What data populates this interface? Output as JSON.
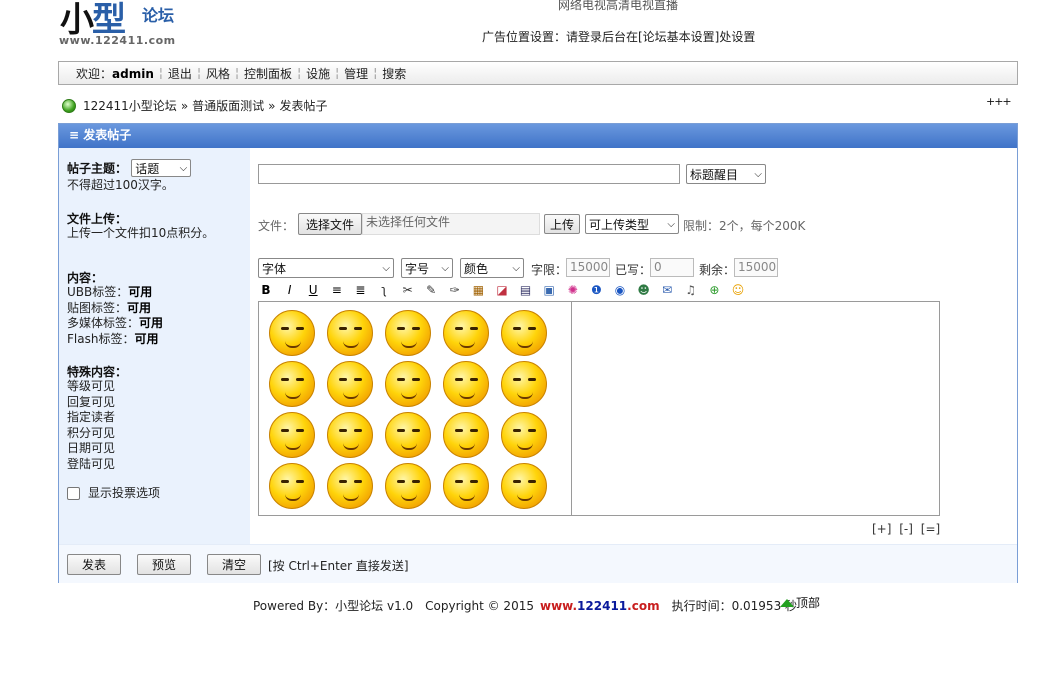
{
  "header": {
    "logo_big": "小",
    "logo_big2": "型",
    "logo_small": "论坛",
    "logo_url": "www.122411.com",
    "ad_top": "网络电视高清电视直播",
    "ad_setting": "广告位置设置：请登录后台在[论坛基本设置]处设置"
  },
  "nav": {
    "welcome": "欢迎：",
    "user": "admin",
    "items": [
      "退出",
      "风格",
      "控制面板",
      "设施",
      "管理",
      "搜索"
    ]
  },
  "breadcrumb": {
    "items": [
      "122411小型论坛",
      "普通版面测试",
      "发表帖子"
    ],
    "separator": "»",
    "jump": "+++"
  },
  "panel": {
    "title": "≡ 发表帖子"
  },
  "side": {
    "subject_label": "帖子主题：",
    "subject_select": "话题",
    "subject_note": "不得超过100汉字。",
    "upload_label": "文件上传：",
    "upload_note": "上传一个文件扣10点积分。",
    "content_label": "内容：",
    "ubb": [
      "UBB标签：",
      "可用"
    ],
    "img": [
      "贴图标签：",
      "可用"
    ],
    "media": [
      "多媒体标签：",
      "可用"
    ],
    "flash": [
      "Flash标签：",
      "可用"
    ],
    "special_label": "特殊内容：",
    "special_items": [
      "等级可见",
      "回复可见",
      "指定读者",
      "积分可见",
      "日期可见",
      "登陆可见"
    ],
    "vote_label": "显示投票选项"
  },
  "content": {
    "title_value": "",
    "title_color_select": "标题醒目",
    "file_label": "文件：",
    "choose_file": "选择文件",
    "no_file": "未选择任何文件",
    "upload_button": "上传",
    "upload_type": "可上传类型",
    "limit_text": "限制：2个，每个200K",
    "font_select": "字体",
    "size_select": "字号",
    "color_select": "颜色",
    "char_limit_label": "字限：",
    "char_limit": "15000",
    "written_label": "已写：",
    "written": "0",
    "remaining_label": "剩余：",
    "remaining": "15000",
    "resize": [
      "[+]",
      "[-]",
      "[=]"
    ]
  },
  "toolbar_icons": [
    "bold-icon",
    "italic-icon",
    "underline-icon",
    "align-center-icon",
    "align-left-icon",
    "pen-icon",
    "strike-icon",
    "wand-icon",
    "paint-icon",
    "paste-icon",
    "eraser-icon",
    "code-icon",
    "image-icon",
    "flash-icon",
    "info-icon",
    "play-icon",
    "user-icon",
    "mail-icon",
    "sound-icon",
    "media-icon",
    "emoji-icon"
  ],
  "toolbar_glyphs": [
    "B",
    "I",
    "U",
    "≡",
    "≣",
    "ʅ",
    "✂",
    "✎",
    "✑",
    "▦",
    "◪",
    "▤",
    "▣",
    "✺",
    "❶",
    "◉",
    "☻",
    "✉",
    "♫",
    "⊕",
    "☺"
  ],
  "actions": {
    "submit": "发表",
    "preview": "预览",
    "clear": "清空",
    "hint": "[按 Ctrl+Enter 直接发送]"
  },
  "footer": {
    "powered": "Powered By：小型论坛 v1.0",
    "copyright": "Copyright © 2015",
    "site_a": "www.",
    "site_b": "122411",
    "site_c": ".com",
    "exec": "执行时间：0.01953 秒",
    "top": "顶部"
  },
  "colors": {
    "panel_head": "#4f82d0",
    "side_bg": "#eaf2fd",
    "site_blue": "#0a1a9c",
    "site_red": "#c81d1d"
  }
}
